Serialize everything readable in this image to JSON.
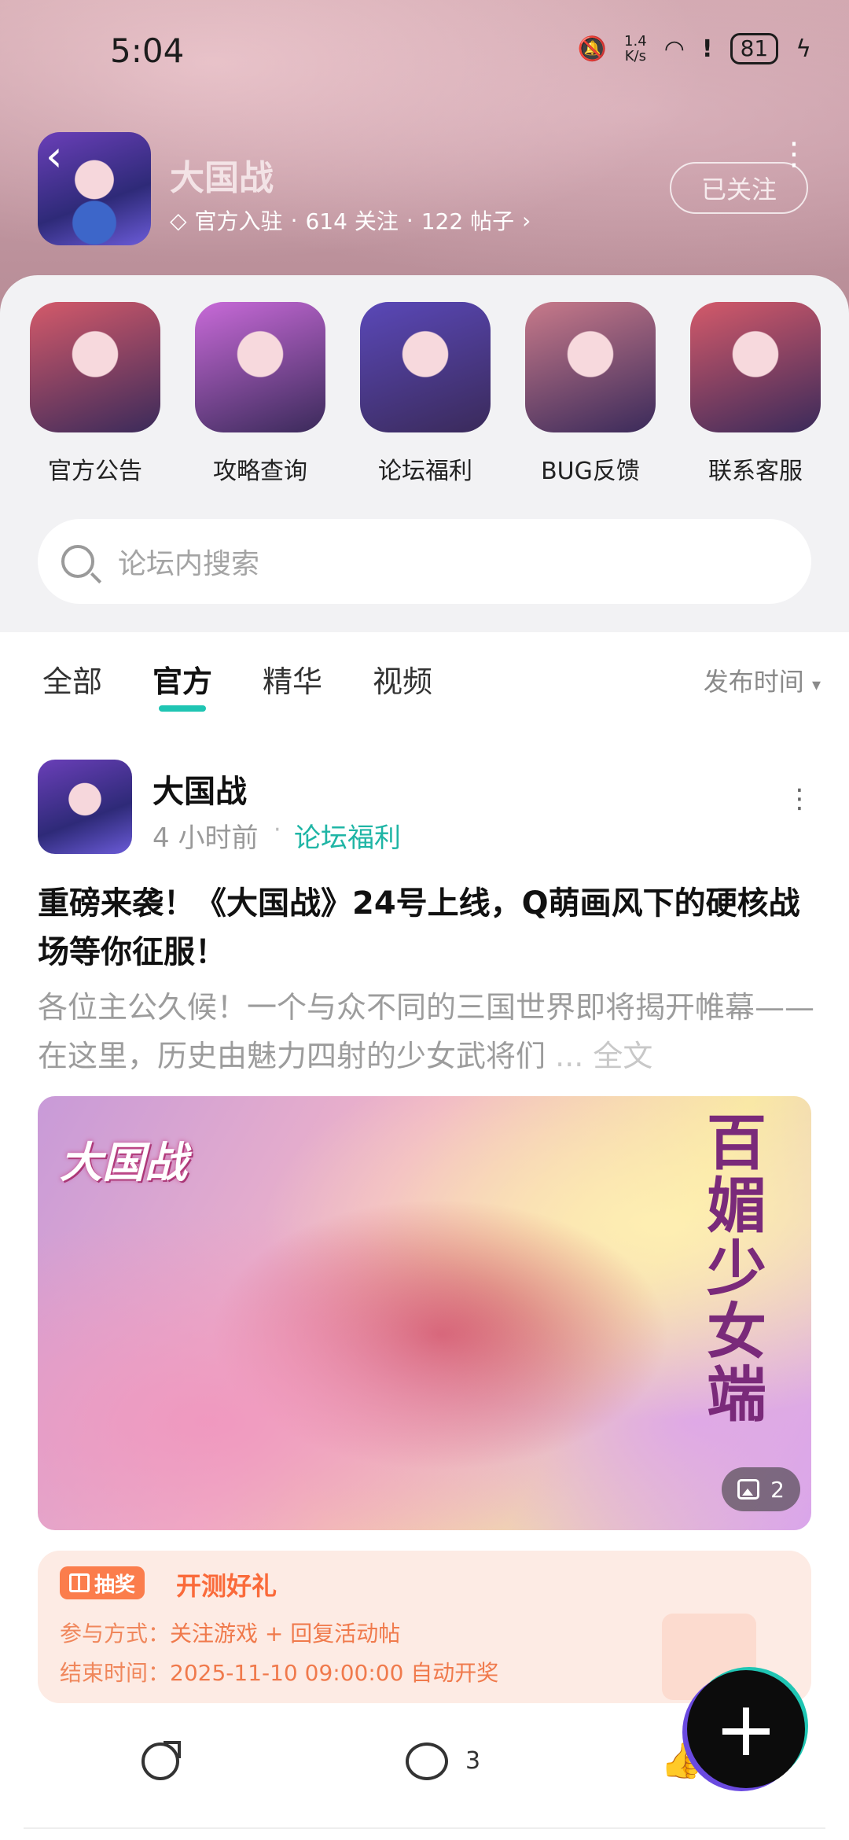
{
  "status_bar": {
    "time": "5:04",
    "net_speed_value": "1.4",
    "net_speed_unit": "K/s",
    "battery": "81"
  },
  "forum": {
    "title": "大国战",
    "official_label": "官方入驻",
    "followers": "614 关注",
    "posts": "122 帖子",
    "separator": "·",
    "follow_button": "已关注"
  },
  "shortcuts": [
    {
      "label": "官方公告",
      "color": "#d45a6a"
    },
    {
      "label": "攻略查询",
      "color": "#c86ad8"
    },
    {
      "label": "论坛福利",
      "color": "#5a48b8"
    },
    {
      "label": "BUG反馈",
      "color": "#c87a8a"
    },
    {
      "label": "联系客服",
      "color": "#d45a6a"
    }
  ],
  "search": {
    "placeholder": "论坛内搜索"
  },
  "tabs": [
    {
      "label": "全部",
      "active": false
    },
    {
      "label": "官方",
      "active": true
    },
    {
      "label": "精华",
      "active": false
    },
    {
      "label": "视频",
      "active": false
    }
  ],
  "sort_label": "发布时间",
  "post": {
    "author": "大国战",
    "time": "4 小时前",
    "dot": "·",
    "category": "论坛福利",
    "title": "重磅来袭！《大国战》24号上线，Q萌画风下的硬核战场等你征服！",
    "excerpt": "各位主公久候！一个与众不同的三国世界即将揭开帷幕——在这里，历史由魅力四射的少女武将们",
    "excerpt_more": "... 全文",
    "image": {
      "logo_text": "大国战",
      "slogan": "百媚少女端",
      "count": "2"
    },
    "lottery": {
      "badge": "抽奖",
      "title": "开测好礼",
      "join_key": "参与方式：",
      "join_value": "关注游戏 + 回复活动帖",
      "end_key": "结束时间：",
      "end_value": "2025-11-10 09:00:00 自动开奖"
    },
    "comment_count": "3"
  },
  "accent_color": "#1fc5b3"
}
